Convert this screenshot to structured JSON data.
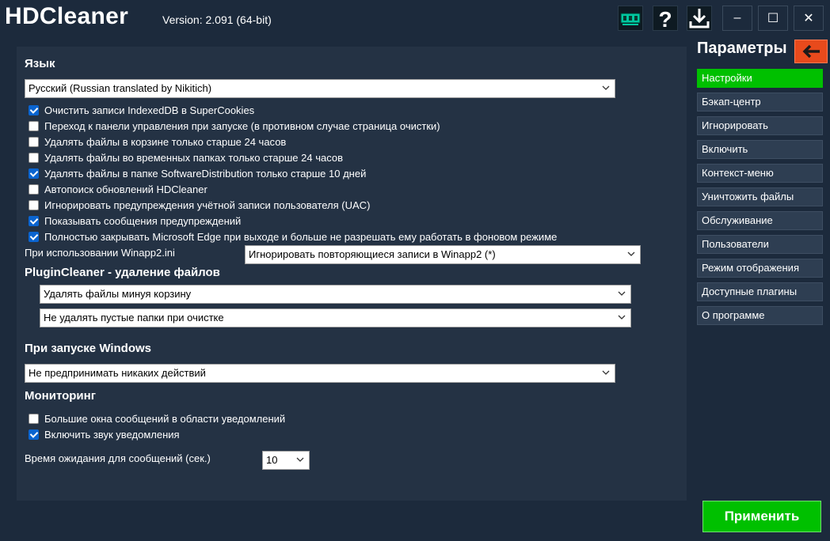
{
  "app": {
    "title": "HDCleaner",
    "version": "Version: 2.091 (64-bit)"
  },
  "titlebar": {
    "icons": [
      "ram-icon",
      "help-icon",
      "download-icon"
    ],
    "minimize": "–",
    "maximize": "☐",
    "close": "✕"
  },
  "language": {
    "heading": "Язык",
    "select": "Русский (Russian translated by Nikitich)",
    "options": [
      {
        "label": "Очистить записи IndexedDB в SuperCookies",
        "checked": true
      },
      {
        "label": "Переход к панели управления при запуске (в противном случае страница очистки)",
        "checked": false
      },
      {
        "label": "Удалять файлы в корзине только старше 24 часов",
        "checked": false
      },
      {
        "label": "Удалять файлы во временных папках только старше 24 часов",
        "checked": false
      },
      {
        "label": "Удалять файлы в папке SoftwareDistribution только старше 10 дней",
        "checked": true
      },
      {
        "label": "Автопоиск обновлений HDCleaner",
        "checked": false
      },
      {
        "label": "Игнорировать предупреждения учётной записи пользователя (UAC)",
        "checked": false
      },
      {
        "label": "Показывать сообщения предупреждений",
        "checked": true
      },
      {
        "label": "Полностью закрывать Microsoft Edge при выходе и больше не разрешать ему работать в фоновом режиме",
        "checked": true
      }
    ],
    "winapp_label": "При использовании Winapp2.ini",
    "winapp_select": "Игнорировать повторяющиеся записи в Winapp2 (*)"
  },
  "plugin": {
    "heading": "PluginCleaner - удаление файлов",
    "select1": "Удалять файлы минуя корзину",
    "select2": "Не удалять пустые папки при очистке"
  },
  "startup": {
    "heading": "При запуске Windows",
    "select": "Не предпринимать никаких действий"
  },
  "monitoring": {
    "heading": "Мониторинг",
    "options": [
      {
        "label": "Большие окна сообщений в области уведомлений",
        "checked": false
      },
      {
        "label": "Включить звук уведомления",
        "checked": true
      }
    ],
    "timeout_label": "Время ожидания для сообщений (сек.)",
    "timeout_value": "10"
  },
  "sidebar": {
    "title": "Параметры",
    "items": [
      {
        "label": "Настройки",
        "active": true
      },
      {
        "label": "Бэкап-центр",
        "active": false
      },
      {
        "label": "Игнорировать",
        "active": false
      },
      {
        "label": "Включить",
        "active": false
      },
      {
        "label": "Контекст-меню",
        "active": false
      },
      {
        "label": "Уничтожить файлы",
        "active": false
      },
      {
        "label": "Обслуживание",
        "active": false
      },
      {
        "label": "Пользователи",
        "active": false
      },
      {
        "label": "Режим отображения",
        "active": false
      },
      {
        "label": "Доступные плагины",
        "active": false
      },
      {
        "label": "О программе",
        "active": false
      }
    ]
  },
  "apply_label": "Применить",
  "colors": {
    "bg": "#1c2a3c",
    "panel": "#243244",
    "accent_green": "#00c000",
    "back_orange": "#e84a1c",
    "check_blue": "#0a64d0"
  }
}
